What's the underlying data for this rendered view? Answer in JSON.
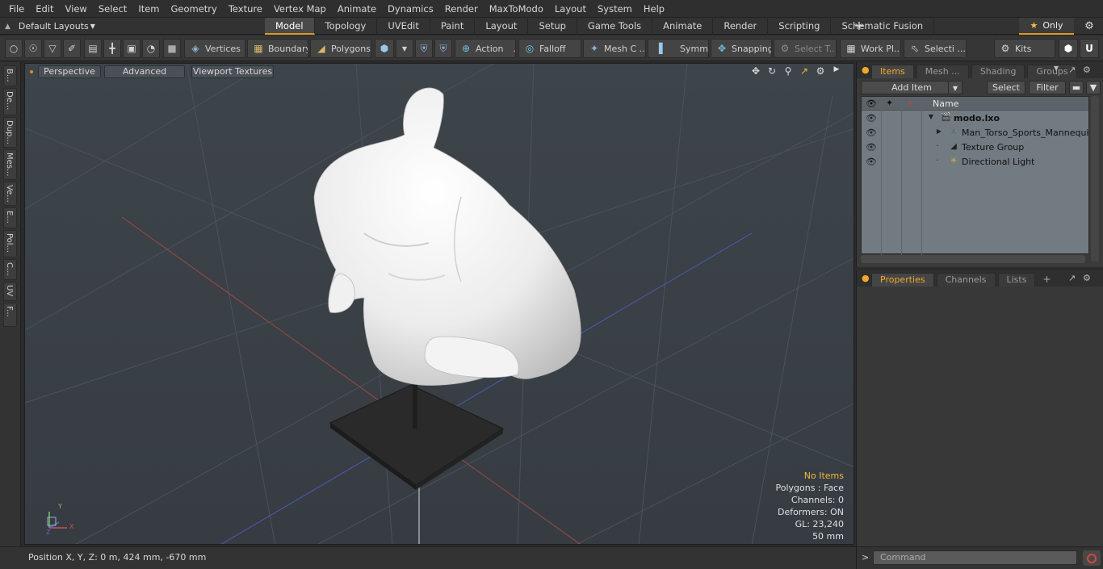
{
  "menu": [
    "File",
    "Edit",
    "View",
    "Select",
    "Item",
    "Geometry",
    "Texture",
    "Vertex Map",
    "Animate",
    "Dynamics",
    "Render",
    "MaxToModo",
    "Layout",
    "System",
    "Help"
  ],
  "layouts": {
    "label": "Default Layouts"
  },
  "tabs": [
    "Model",
    "Topology",
    "UVEdit",
    "Paint",
    "Layout",
    "Setup",
    "Game Tools",
    "Animate",
    "Render",
    "Scripting",
    "Schematic Fusion"
  ],
  "only_label": "Only",
  "toolbar": {
    "vertices": "Vertices",
    "boundary": "Boundary",
    "polygons": "Polygons",
    "action": "Action",
    "falloff": "Falloff",
    "mesh": "Mesh C ...",
    "symm": "Symm ...",
    "snapping": "Snapping",
    "select_t": "Select T...",
    "work_pl": "Work Pl...",
    "selecti": "Selecti ...",
    "kits": "Kits"
  },
  "left_tabs": [
    "B...",
    "De...",
    "Dup...",
    "Mes...",
    "Ve...",
    "E...",
    "Pol...",
    "C...",
    "UV",
    "F..."
  ],
  "viewport": {
    "perspective": "Perspective",
    "advanced": "Advanced",
    "textures": "Viewport Textures",
    "stats": [
      "No Items",
      "Polygons : Face",
      "Channels: 0",
      "Deformers: ON",
      "GL: 23,240",
      "50 mm"
    ]
  },
  "axis": {
    "y": "Y",
    "x": "X",
    "z": "Z"
  },
  "status": {
    "position": "Position X, Y, Z:   0 m, 424 mm, -670 mm"
  },
  "items_panel": {
    "tabs": [
      "Items",
      "Mesh ...",
      "Shading",
      "Groups"
    ],
    "add_item": "Add Item",
    "select": "Select",
    "filter": "Filter",
    "name_header": "Name",
    "rows": [
      "modo.lxo",
      "Man_Torso_Sports_Mannequi...",
      "Texture Group",
      "Directional Light"
    ]
  },
  "props_panel": {
    "tabs": [
      "Properties",
      "Channels",
      "Lists"
    ]
  },
  "command": {
    "placeholder": "Command",
    "prompt": ">"
  },
  "colors": {
    "accent": "#f0a92c",
    "viewport_bg": "#3a4147"
  }
}
